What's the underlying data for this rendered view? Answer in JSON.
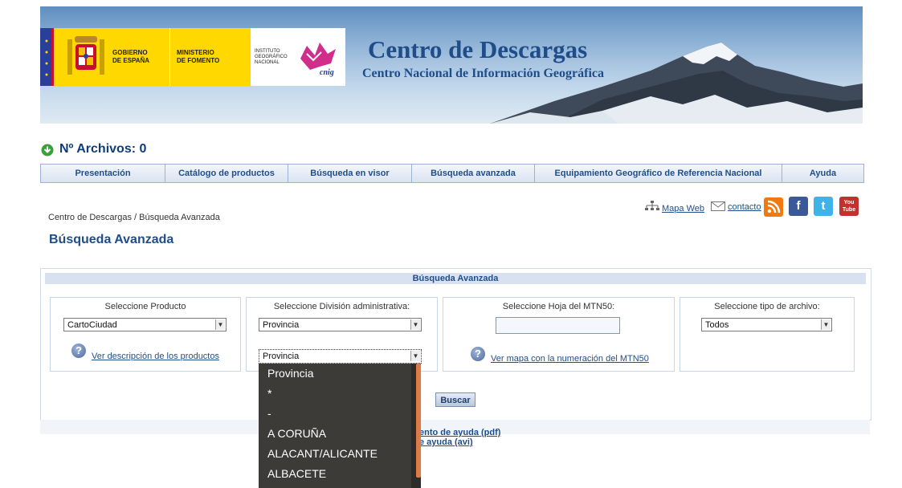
{
  "banner": {
    "title": "Centro de Descargas",
    "subtitle": "Centro Nacional de Información Geográfica",
    "logo_gobierno": "GOBIERNO\nDE ESPAÑA",
    "logo_ministerio": "MINISTERIO\nDE FOMENTO",
    "logo_instituto": "INSTITUTO\nGEOGRÁFICO\nNACIONAL",
    "logo_cnig": "cnig"
  },
  "archives": {
    "label": "Nº Archivos: 0"
  },
  "nav": {
    "items": [
      "Presentación",
      "Catálogo de productos",
      "Búsqueda en visor",
      "Búsqueda avanzada",
      "Equipamiento Geográfico de Referencia Nacional",
      "Ayuda"
    ]
  },
  "breadcrumb": "Centro de Descargas / Búsqueda Avanzada",
  "page_title": "Búsqueda Avanzada",
  "toplinks": {
    "mapa_web": "Mapa Web",
    "contacto": "contacto"
  },
  "social_icons": [
    "rss-icon",
    "facebook-icon",
    "twitter-icon",
    "youtube-icon"
  ],
  "social_glyphs": {
    "facebook": "f",
    "twitter": "t",
    "youtube": "You\nTube"
  },
  "form": {
    "header": "Búsqueda Avanzada",
    "producto": {
      "label": "Seleccione Producto",
      "value": "CartoCiudad",
      "help_link": "Ver descripción de los productos"
    },
    "division": {
      "label": "Seleccione División administrativa:",
      "value": "Provincia",
      "second_value": "Provincia"
    },
    "mtn50": {
      "label": "Seleccione Hoja del MTN50:",
      "value": "",
      "help_link": "Ver mapa con la numeración del MTN50"
    },
    "tipo": {
      "label": "Seleccione tipo de archivo:",
      "value": "Todos"
    },
    "buscar": "Buscar"
  },
  "footer_links": {
    "pdf": "ento de ayuda (pdf)",
    "avi": "e ayuda (avi)"
  },
  "dropdown": {
    "options": [
      "Provincia",
      "*",
      "-",
      "A CORUÑA",
      "ALACANT/ALICANTE",
      "ALBACETE"
    ]
  },
  "colors": {
    "accent": "#1f4d8a",
    "nav_bg": "#d9e3f1",
    "dropdown_bg": "#3d3b37",
    "scroll_thumb": "#e07a44",
    "logo_yellow": "#ffd800"
  }
}
